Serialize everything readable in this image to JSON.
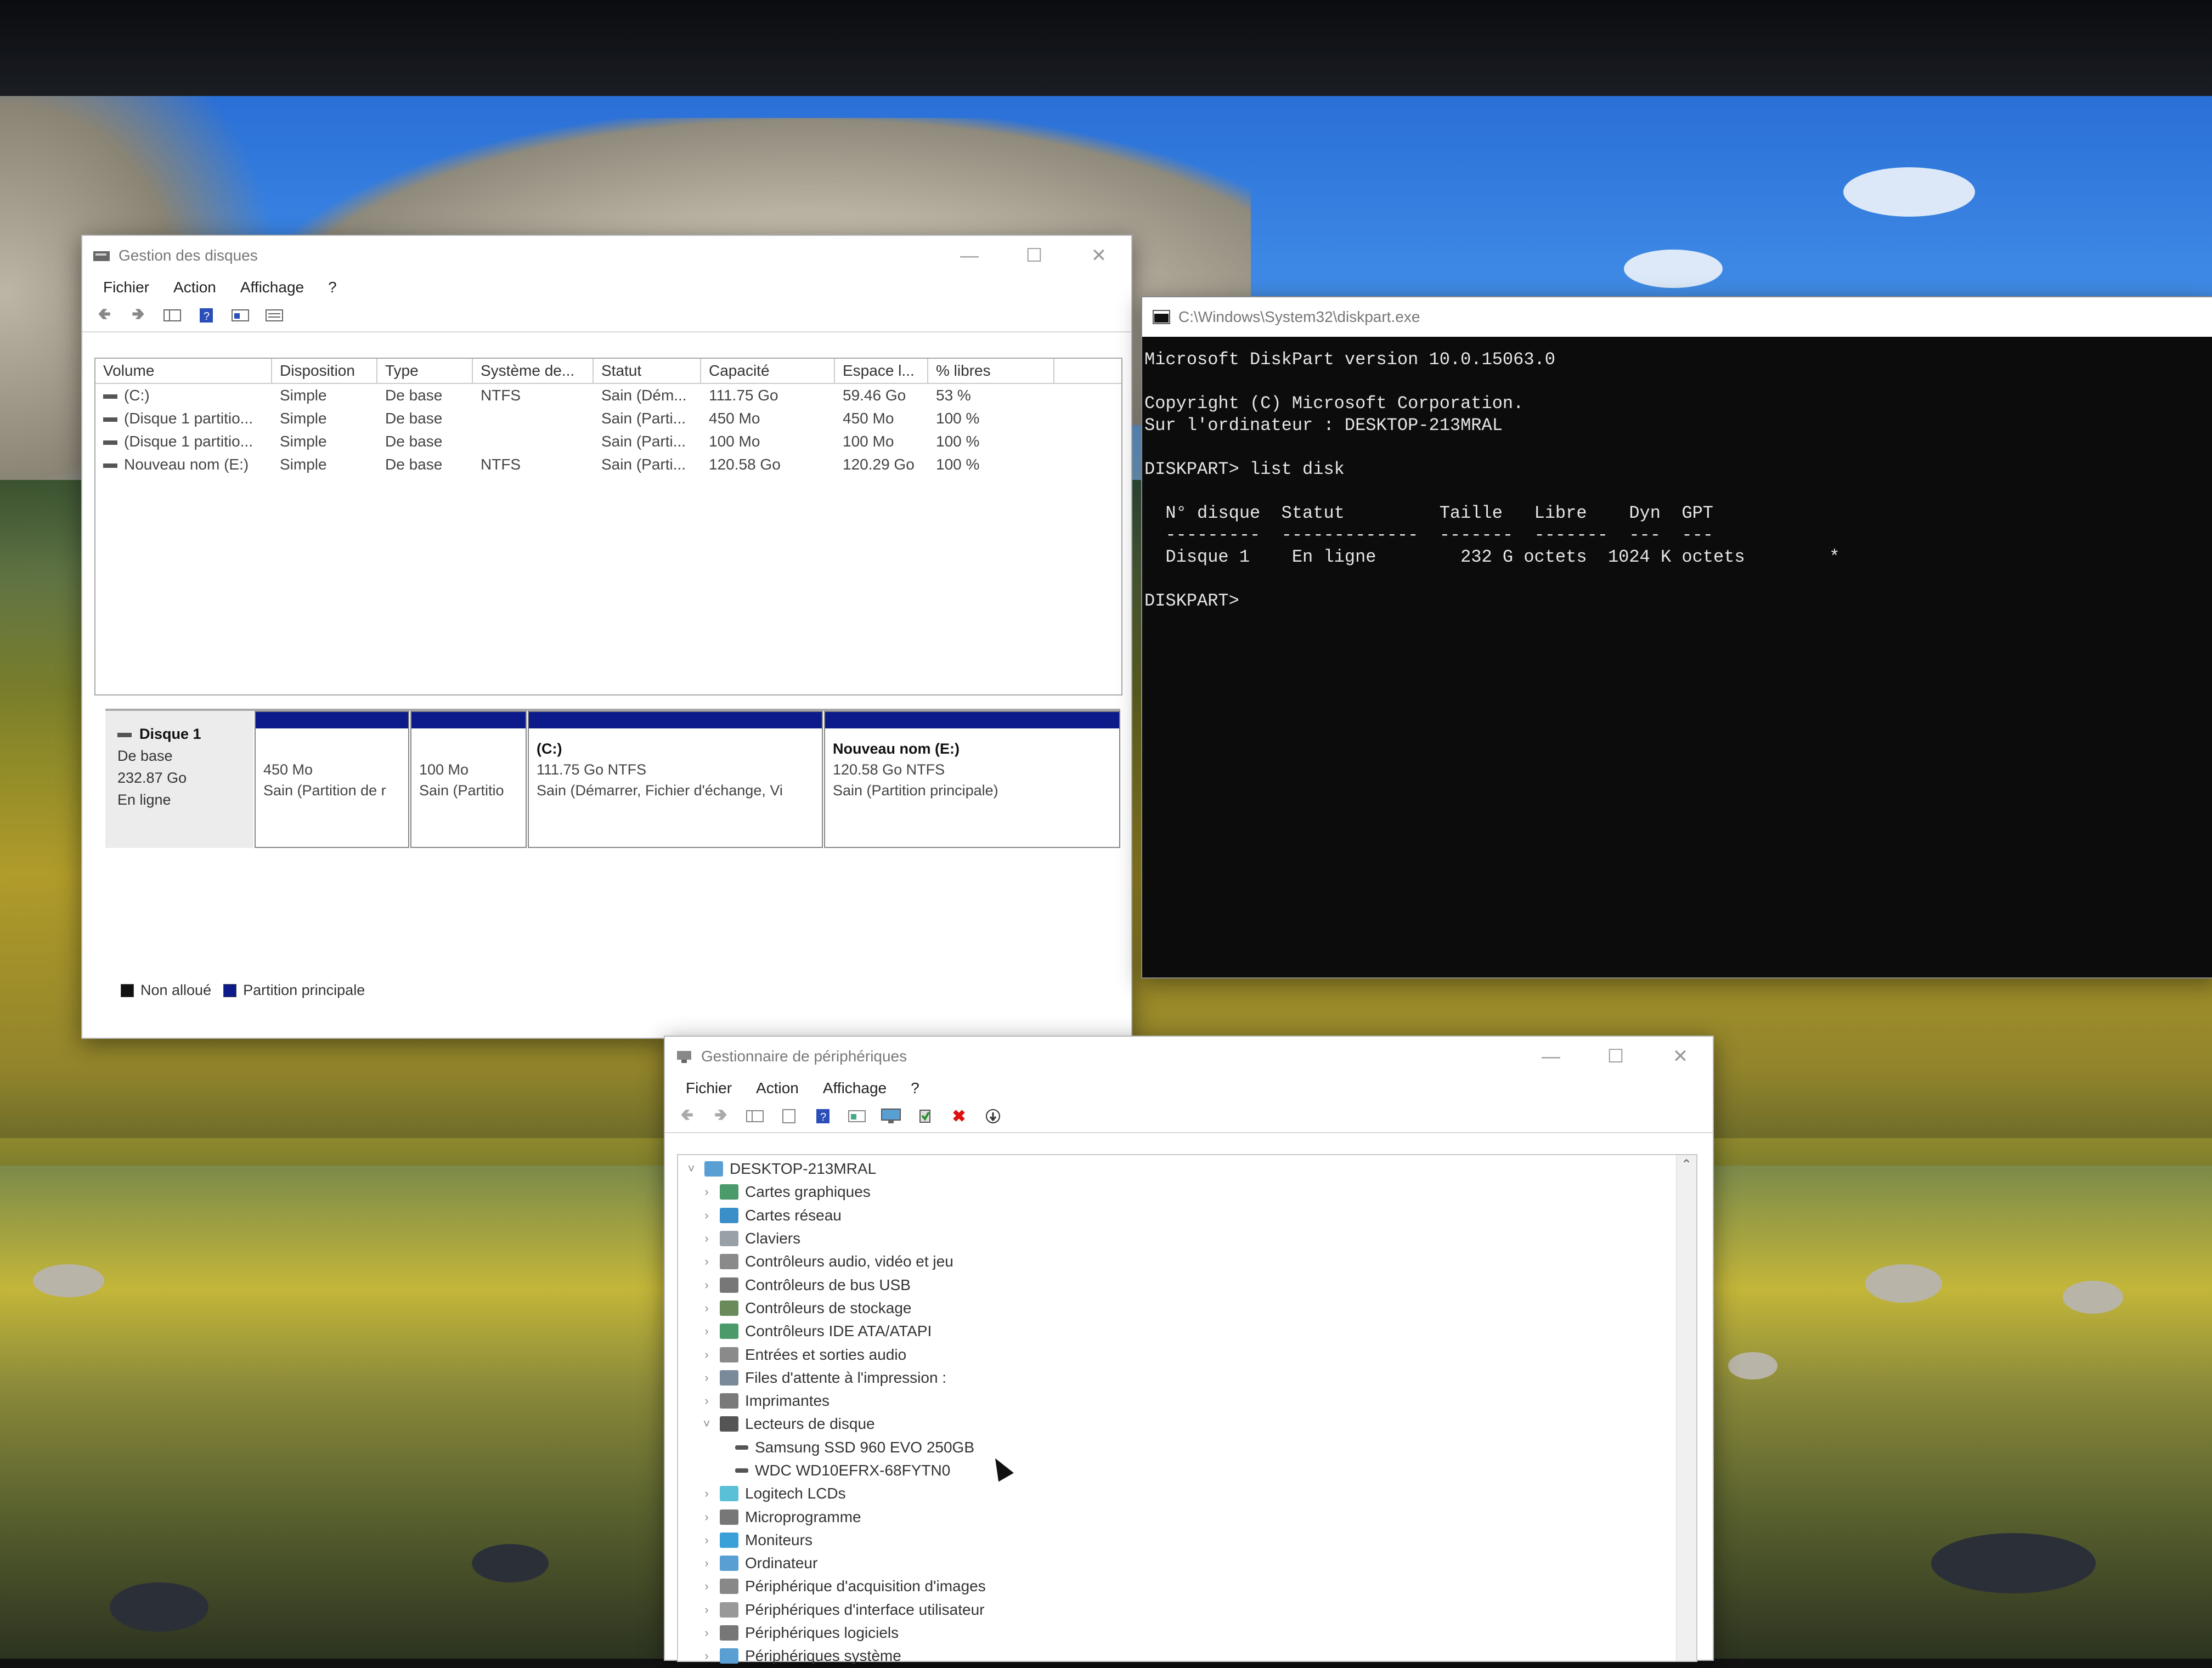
{
  "disk_management": {
    "title": "Gestion des disques",
    "menu": [
      "Fichier",
      "Action",
      "Affichage",
      "?"
    ],
    "columns": [
      "Volume",
      "Disposition",
      "Type",
      "Système de...",
      "Statut",
      "Capacité",
      "Espace l...",
      "% libres"
    ],
    "volumes": [
      [
        "(C:)",
        "Simple",
        "De base",
        "NTFS",
        "Sain (Dém...",
        "111.75 Go",
        "59.46 Go",
        "53 %"
      ],
      [
        "(Disque 1 partitio...",
        "Simple",
        "De base",
        "",
        "Sain (Parti...",
        "450 Mo",
        "450 Mo",
        "100 %"
      ],
      [
        "(Disque 1 partitio...",
        "Simple",
        "De base",
        "",
        "Sain (Parti...",
        "100 Mo",
        "100 Mo",
        "100 %"
      ],
      [
        "Nouveau nom (E:)",
        "Simple",
        "De base",
        "NTFS",
        "Sain (Parti...",
        "120.58 Go",
        "120.29 Go",
        "100 %"
      ]
    ],
    "disk": {
      "name": "Disque 1",
      "type": "De base",
      "size": "232.87 Go",
      "status": "En ligne"
    },
    "partitions": [
      {
        "name": "",
        "size": "450 Mo",
        "status": "Sain (Partition de r"
      },
      {
        "name": "",
        "size": "100 Mo",
        "status": "Sain (Partitio"
      },
      {
        "name": "(C:)",
        "size": "111.75 Go NTFS",
        "status": "Sain (Démarrer, Fichier d'échange, Vi"
      },
      {
        "name": "Nouveau nom  (E:)",
        "size": "120.58 Go NTFS",
        "status": "Sain (Partition principale)"
      }
    ],
    "legend": {
      "unallocated": "Non alloué",
      "primary": "Partition principale"
    },
    "colors": {
      "primary_partition": "#0d1a8a",
      "unallocated": "#111111"
    }
  },
  "console": {
    "title": "C:\\Windows\\System32\\diskpart.exe",
    "lines": [
      "Microsoft DiskPart version 10.0.15063.0",
      "",
      "Copyright (C) Microsoft Corporation.",
      "Sur l'ordinateur : DESKTOP-213MRAL",
      "",
      "DISKPART> list disk",
      "",
      "  N° disque  Statut         Taille   Libre    Dyn  GPT",
      "  ---------  -------------  -------  -------  ---  ---",
      "  Disque 1    En ligne        232 G octets  1024 K octets        *",
      "",
      "DISKPART>"
    ]
  },
  "device_manager": {
    "title": "Gestionnaire de périphériques",
    "menu": [
      "Fichier",
      "Action",
      "Affichage",
      "?"
    ],
    "tree": [
      {
        "label": "DESKTOP-213MRAL",
        "level": 0,
        "expanded": true,
        "icon": "computer-icon"
      },
      {
        "label": "Cartes graphiques",
        "level": 1,
        "expanded": false,
        "icon": "display-adapter-icon"
      },
      {
        "label": "Cartes réseau",
        "level": 1,
        "expanded": false,
        "icon": "network-adapter-icon"
      },
      {
        "label": "Claviers",
        "level": 1,
        "expanded": false,
        "icon": "keyboard-icon"
      },
      {
        "label": "Contrôleurs audio, vidéo et jeu",
        "level": 1,
        "expanded": false,
        "icon": "audio-icon"
      },
      {
        "label": "Contrôleurs de bus USB",
        "level": 1,
        "expanded": false,
        "icon": "usb-icon"
      },
      {
        "label": "Contrôleurs de stockage",
        "level": 1,
        "expanded": false,
        "icon": "storage-controller-icon"
      },
      {
        "label": "Contrôleurs IDE ATA/ATAPI",
        "level": 1,
        "expanded": false,
        "icon": "ide-icon"
      },
      {
        "label": "Entrées et sorties audio",
        "level": 1,
        "expanded": false,
        "icon": "audio-io-icon"
      },
      {
        "label": "Files d'attente à l'impression :",
        "level": 1,
        "expanded": false,
        "icon": "print-queue-icon"
      },
      {
        "label": "Imprimantes",
        "level": 1,
        "expanded": false,
        "icon": "printer-icon"
      },
      {
        "label": "Lecteurs de disque",
        "level": 1,
        "expanded": true,
        "icon": "disk-drive-icon"
      },
      {
        "label": "Samsung SSD 960 EVO 250GB",
        "level": 2,
        "expanded": false,
        "icon": "drive-icon"
      },
      {
        "label": "WDC WD10EFRX-68FYTN0",
        "level": 2,
        "expanded": false,
        "icon": "drive-icon"
      },
      {
        "label": "Logitech LCDs",
        "level": 1,
        "expanded": false,
        "icon": "lcd-icon"
      },
      {
        "label": "Microprogramme",
        "level": 1,
        "expanded": false,
        "icon": "firmware-icon"
      },
      {
        "label": "Moniteurs",
        "level": 1,
        "expanded": false,
        "icon": "monitor-icon"
      },
      {
        "label": "Ordinateur",
        "level": 1,
        "expanded": false,
        "icon": "computer-icon"
      },
      {
        "label": "Périphérique d'acquisition d'images",
        "level": 1,
        "expanded": false,
        "icon": "camera-icon"
      },
      {
        "label": "Périphériques d'interface utilisateur",
        "level": 1,
        "expanded": false,
        "icon": "hid-icon"
      },
      {
        "label": "Périphériques logiciels",
        "level": 1,
        "expanded": false,
        "icon": "software-device-icon"
      },
      {
        "label": "Périphériques système",
        "level": 1,
        "expanded": false,
        "icon": "system-device-icon"
      }
    ]
  }
}
